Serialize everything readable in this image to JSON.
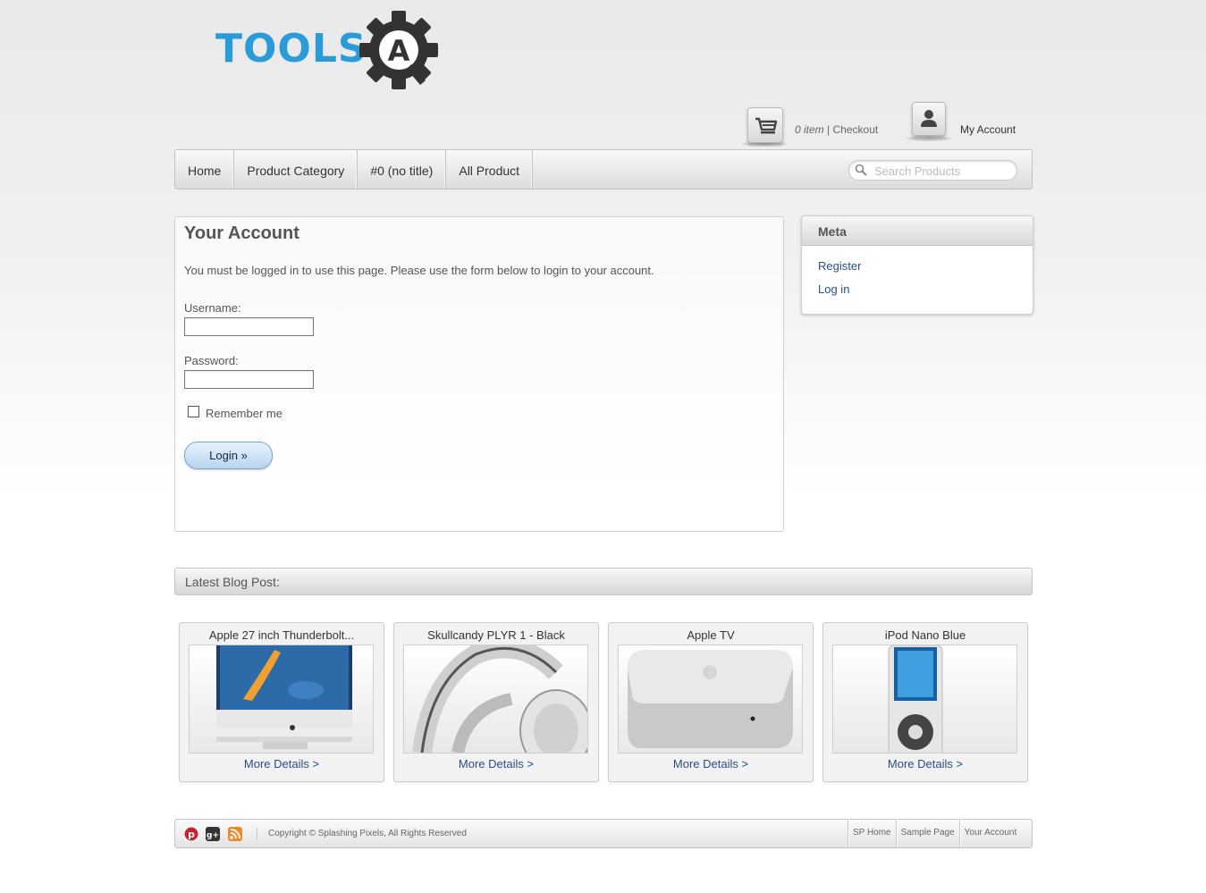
{
  "brand": {
    "logo_text": "TOOLS",
    "logo_mark": "A"
  },
  "header": {
    "cart_count": "0 item",
    "cart_sep": "|",
    "checkout_label": "Checkout",
    "account_label": "My Account"
  },
  "nav": {
    "items": [
      {
        "label": "Home"
      },
      {
        "label": "Product Category"
      },
      {
        "label": "#0 (no title)"
      },
      {
        "label": "All Product"
      }
    ],
    "search_placeholder": "Search Products"
  },
  "account": {
    "title": "Your Account",
    "message": "You must be logged in to use this page. Please use the form below to login to your account.",
    "username_label": "Username:",
    "username_value": "",
    "password_label": "Password:",
    "password_value": "",
    "remember_label": "Remember me",
    "remember_checked": false,
    "login_label": "Login »"
  },
  "meta": {
    "title": "Meta",
    "links": [
      {
        "label": "Register"
      },
      {
        "label": "Log in"
      }
    ]
  },
  "blog": {
    "title": "Latest Blog Post:"
  },
  "products": [
    {
      "title": "Apple 27 inch Thunderbolt...",
      "more": "More Details >",
      "image": "imac-image"
    },
    {
      "title": "Skullcandy PLYR 1 - Black",
      "more": "More Details >",
      "image": "headphones-image"
    },
    {
      "title": "Apple TV",
      "more": "More Details >",
      "image": "apple-tv-image"
    },
    {
      "title": "iPod Nano Blue",
      "more": "More Details >",
      "image": "ipod-image"
    }
  ],
  "footer": {
    "social": [
      "pinterest-icon",
      "google-plus-icon",
      "rss-icon"
    ],
    "copyright": "Copyright © Splashing Pixels, All Rights Reserved",
    "links": [
      {
        "label": "SP Home"
      },
      {
        "label": "Sample Page"
      },
      {
        "label": "Your Account"
      }
    ]
  },
  "colors": {
    "brand_blue": "#2a9ad8",
    "link": "#2a4e8a",
    "gear": "#333333"
  }
}
